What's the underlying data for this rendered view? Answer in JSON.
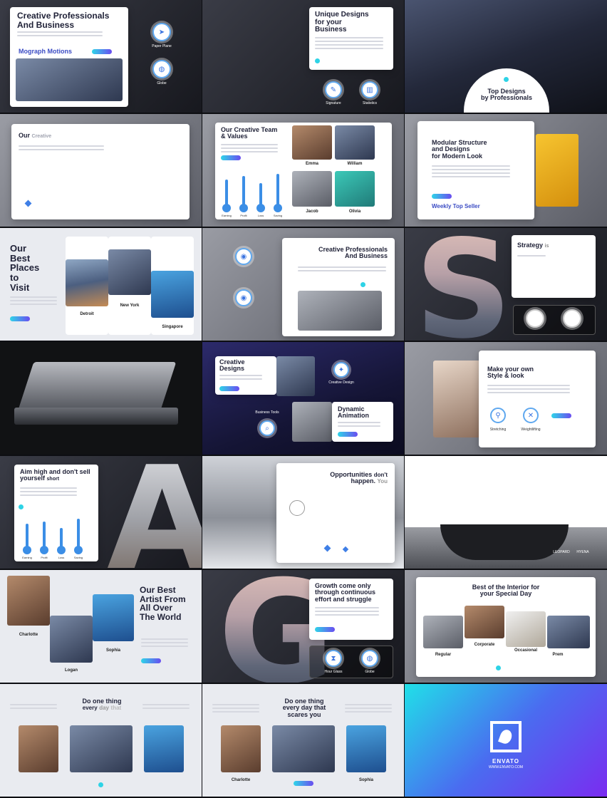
{
  "slides": {
    "s1": {
      "title1": "Creative Professionals",
      "title2": "And Business",
      "sub": "Mograph Motions",
      "cap1": "Paper Plane",
      "cap2": "Globe"
    },
    "s2": {
      "title1": "Unique Designs",
      "title2": "for your",
      "title3": "Business",
      "cap1": "Signature",
      "cap2": "Statistics"
    },
    "s3": {
      "title1": "Top Designs",
      "title2": "by Professionals"
    },
    "s4": {
      "title": "Our",
      "sub": "Creative"
    },
    "s5": {
      "title1": "Our Creative Team",
      "title2": "& Values",
      "bars": [
        {
          "label": "Earning",
          "value": 77
        },
        {
          "label": "Profit",
          "value": 86
        },
        {
          "label": "Loss",
          "value": 67
        },
        {
          "label": "Saving",
          "value": 92
        }
      ],
      "members": [
        "Emma",
        "William",
        "Jacob",
        "Olivia"
      ]
    },
    "s6": {
      "title1": "Modular Structure",
      "title2": "and Designs",
      "title3": "for Modern Look",
      "sub": "Weekly Top Seller"
    },
    "s7": {
      "title1": "Our",
      "title2": "Best",
      "title3": "Places",
      "title4": "to",
      "title5": "Visit",
      "places": [
        "Detroit",
        "New York",
        "Singapore"
      ]
    },
    "s8": {
      "title1": "Creative Professionals",
      "title2": "And Business"
    },
    "s9": {
      "letter": "S",
      "title": "Strategy",
      "title2": "is"
    },
    "s11": {
      "title1": "Creative",
      "title2": "Designs",
      "title3": "Dynamic",
      "title4": "Animation",
      "cap1": "Creative Design",
      "cap2": "Business Tools"
    },
    "s12": {
      "title1": "Make your own",
      "title2": "Style & look",
      "cap1": "Stretching",
      "cap2": "Weightlifting"
    },
    "s13": {
      "title1": "Aim high and don't sell",
      "title2": "yourself",
      "title3": "short",
      "bars": [
        {
          "label": "Earning",
          "value": 74
        },
        {
          "label": "Profit",
          "value": 81
        },
        {
          "label": "Loss",
          "value": 62
        },
        {
          "label": "Saving",
          "value": 88
        }
      ],
      "letter": "A"
    },
    "s14": {
      "title1": "Opportunities",
      "title2": "don't",
      "title3": "happen.",
      "title4": "You"
    },
    "s15": {
      "cap1": "LEOPARD",
      "cap2": "HYENA"
    },
    "s16": {
      "title1": "Our Best",
      "title2": "Artist From",
      "title3": "All Over",
      "title4": "The World",
      "names": [
        "Charlotte",
        "Logan",
        "Sophia"
      ]
    },
    "s17": {
      "letter": "G",
      "title1": "Growth come only",
      "title2": "through continuous",
      "title3": "effort and struggle",
      "cap1": "Hour Glass",
      "cap2": "Globe"
    },
    "s18": {
      "title1": "Best of the Interior for",
      "title2": "your Special Day",
      "rooms": [
        "Regular",
        "Corporate",
        "Occasional",
        "Prem"
      ]
    },
    "s19": {
      "title1": "Do one thing",
      "title2": "every",
      "title3": "day",
      "title4": "that"
    },
    "s20": {
      "title1": "Do one thing",
      "title2": "every day that",
      "title3": "scares you",
      "names": [
        "Charlotte",
        "Sophia"
      ]
    },
    "s21": {
      "brand": "ENVATO",
      "url": "WWW.ENVATO.COM"
    }
  },
  "icons": [
    "paper-plane-icon",
    "globe-icon",
    "signature-icon",
    "statistics-icon",
    "hourglass-icon",
    "magnifier-icon",
    "running-icon",
    "weightlifting-icon",
    "envato-leaf-icon"
  ],
  "colors": {
    "accent_start": "#2fd5e8",
    "accent_end": "#6a4cf0",
    "bar": "#3b8ee6"
  }
}
